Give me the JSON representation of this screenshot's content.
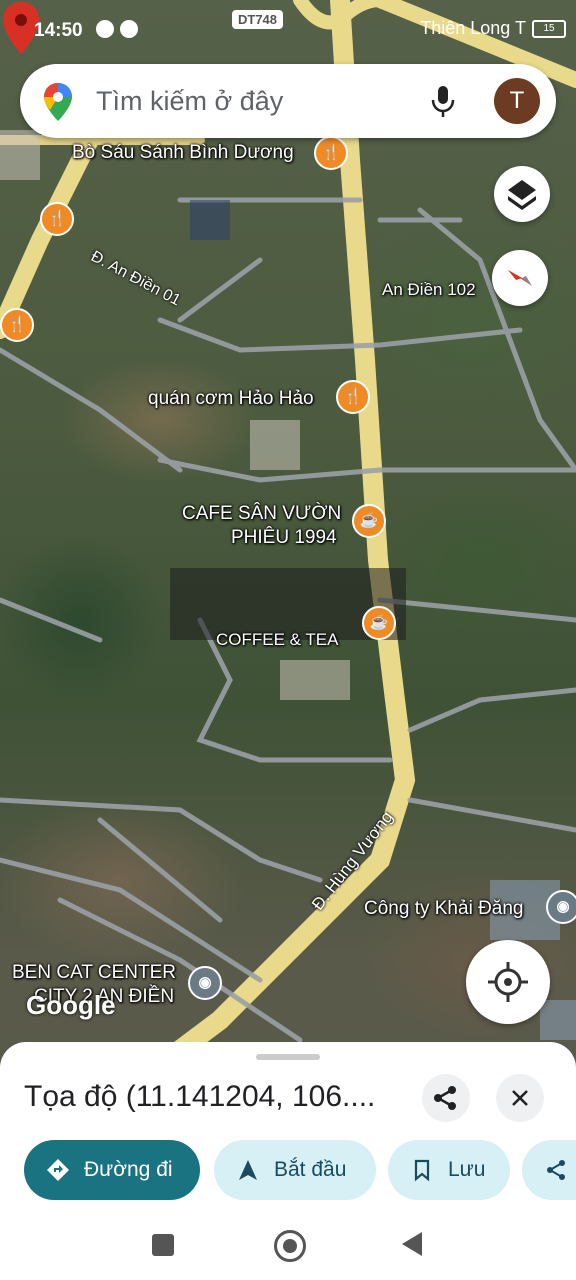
{
  "status_bar": {
    "time": "14:50",
    "carrier": "Thiên Long T",
    "battery": "15"
  },
  "search": {
    "placeholder": "Tìm kiếm ở đây",
    "avatar_letter": "T"
  },
  "map": {
    "route_badge": "DT748",
    "labels": {
      "bo_sau": "Bò Sáu Sánh Bình Dương",
      "an_dien_01": "Đ. An Điền 01",
      "an_dien_102": "An Điền 102",
      "quan_com": "quán cơm Hảo Hảo",
      "cafe_line1": "CAFE SÂN VƯỜN",
      "cafe_line2": "PHIÊU 1994",
      "coffee_tea": "COFFEE & TEA",
      "hung_vuong": "Đ. Hùng Vương",
      "khai_dang": "Công ty Khải Đăng",
      "ben_cat_line1": "BEN CAT CENTER",
      "ben_cat_line2": "CITY 2 AN ĐIỀN"
    },
    "attribution": "Google"
  },
  "place_sheet": {
    "title": "Tọa độ (11.141204, 106....",
    "actions": {
      "directions": "Đường đi",
      "start": "Bắt đầu",
      "save": "Lưu"
    }
  },
  "colors": {
    "primary_chip": "#1a7381",
    "secondary_chip": "#d6f0f5",
    "poi_orange": "#f08a25",
    "pin_red": "#d93025",
    "road_yellow": "#e8d27a"
  }
}
